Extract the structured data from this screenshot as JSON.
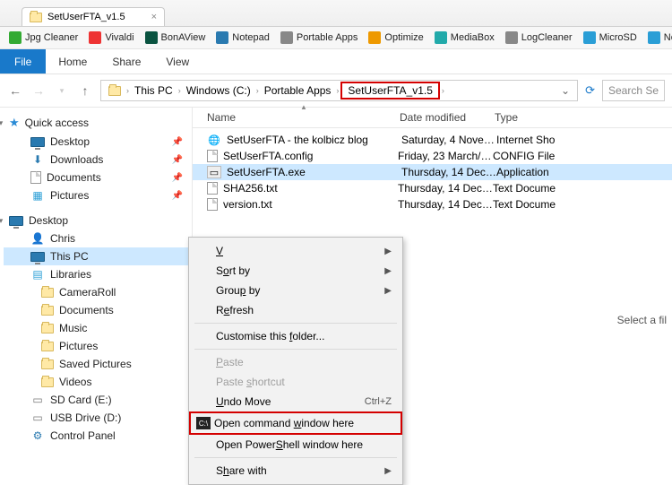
{
  "browser": {
    "tab_title": "SetUserFTA_v1.5"
  },
  "bookmarks": [
    {
      "label": "Jpg Cleaner",
      "color": "#3a3"
    },
    {
      "label": "Vivaldi",
      "color": "#e33"
    },
    {
      "label": "BonAView",
      "color": "#0a5340"
    },
    {
      "label": "Notepad",
      "color": "#2a7ab0"
    },
    {
      "label": "Portable Apps",
      "color": "#888"
    },
    {
      "label": "Optimize",
      "color": "#e90"
    },
    {
      "label": "MediaBox",
      "color": "#2aa"
    },
    {
      "label": "LogCleaner",
      "color": "#888"
    },
    {
      "label": "MicroSD",
      "color": "#2a9ed6"
    },
    {
      "label": "Network",
      "color": "#2a9ed6"
    }
  ],
  "ribbon": {
    "file": "File",
    "tabs": [
      "Home",
      "Share",
      "View"
    ]
  },
  "breadcrumb": {
    "items": [
      "This PC",
      "Windows (C:)",
      "Portable Apps",
      "SetUserFTA_v1.5"
    ]
  },
  "search_placeholder": "Search Se",
  "columns": {
    "name": "Name",
    "date": "Date modified",
    "type": "Type"
  },
  "files": [
    {
      "name": "SetUserFTA - the kolbicz blog",
      "date": "Saturday, 4 Novem…",
      "type": "Internet Sho",
      "icon": "globe"
    },
    {
      "name": "SetUserFTA.config",
      "date": "Friday, 23 March/2…",
      "type": "CONFIG File",
      "icon": "doc"
    },
    {
      "name": "SetUserFTA.exe",
      "date": "Thursday, 14 Dece…",
      "type": "Application",
      "icon": "app",
      "selected": true
    },
    {
      "name": "SHA256.txt",
      "date": "Thursday, 14 Dece…",
      "type": "Text Docume",
      "icon": "doc"
    },
    {
      "name": "version.txt",
      "date": "Thursday, 14 Dece…",
      "type": "Text Docume",
      "icon": "doc"
    }
  ],
  "hint": "Select a fil",
  "sidebar": {
    "quick": "Quick access",
    "quick_items": [
      {
        "label": "Desktop",
        "pin": true,
        "icon": "desktop"
      },
      {
        "label": "Downloads",
        "pin": true,
        "icon": "down"
      },
      {
        "label": "Documents",
        "pin": true,
        "icon": "doc"
      },
      {
        "label": "Pictures",
        "pin": true,
        "icon": "pic"
      }
    ],
    "desktop": "Desktop",
    "desktop_items": [
      {
        "label": "Chris",
        "icon": "user"
      },
      {
        "label": "This PC",
        "icon": "pc",
        "selected": true
      },
      {
        "label": "Libraries",
        "icon": "lib"
      },
      {
        "label": "CameraRoll",
        "icon": "folder",
        "indent": true
      },
      {
        "label": "Documents",
        "icon": "folder",
        "indent": true
      },
      {
        "label": "Music",
        "icon": "folder",
        "indent": true
      },
      {
        "label": "Pictures",
        "icon": "folder",
        "indent": true
      },
      {
        "label": "Saved Pictures",
        "icon": "folder",
        "indent": true
      },
      {
        "label": "Videos",
        "icon": "folder",
        "indent": true
      },
      {
        "label": "SD Card (E:)",
        "icon": "drive"
      },
      {
        "label": "USB Drive (D:)",
        "icon": "drive"
      },
      {
        "label": "Control Panel",
        "icon": "cpl"
      }
    ]
  },
  "ctx": {
    "view": "View",
    "sort": "Sort by",
    "group": "Group by",
    "refresh": "Refresh",
    "customise": "Customise this folder...",
    "paste": "Paste",
    "paste_shortcut": "Paste shortcut",
    "undo": "Undo Move",
    "undo_key": "Ctrl+Z",
    "cmd": "Open command window here",
    "cmd_u": "w",
    "ps": "Open PowerShell window here",
    "share": "Share with"
  }
}
